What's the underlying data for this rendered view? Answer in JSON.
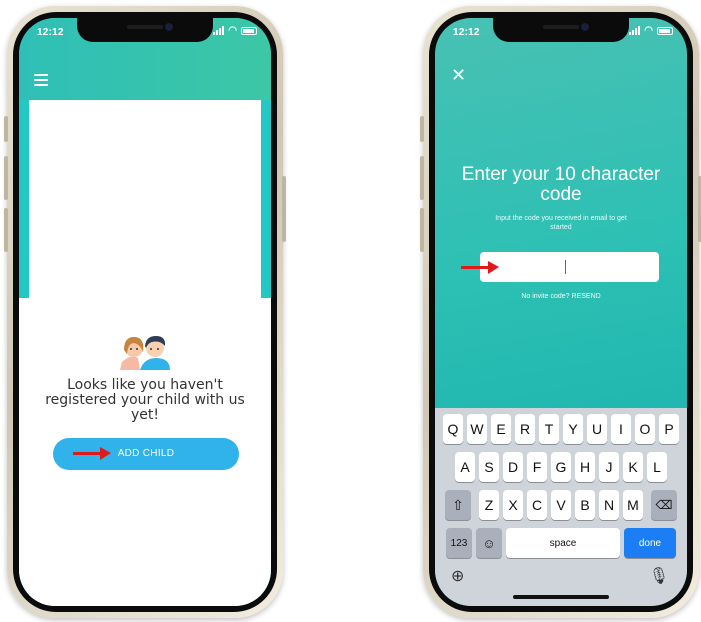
{
  "phone_left": {
    "status": {
      "time": "12:12"
    },
    "menu_icon": "hamburger-icon",
    "illustration": "children-icon",
    "empty_message": "Looks like you haven't registered your child with us yet!",
    "add_child_label": "ADD CHILD",
    "colors": {
      "header": "#2fbfb6",
      "button": "#2fb3ea",
      "arrow": "#e0191d"
    }
  },
  "phone_right": {
    "status": {
      "time": "12:12"
    },
    "close_icon": "close-icon",
    "title": "Enter your 10 character code",
    "subtitle": "Input the code you received in email to get started",
    "code_value": "",
    "resend_text": "No invite code? RESEND",
    "keyboard": {
      "row1": [
        "Q",
        "W",
        "E",
        "R",
        "T",
        "Y",
        "U",
        "I",
        "O",
        "P"
      ],
      "row2": [
        "A",
        "S",
        "D",
        "F",
        "G",
        "H",
        "J",
        "K",
        "L"
      ],
      "row3": [
        "Z",
        "X",
        "C",
        "V",
        "B",
        "N",
        "M"
      ],
      "key_123": "123",
      "space": "space",
      "done": "done"
    },
    "colors": {
      "background": "#2ec0b4",
      "done_key": "#1c7ef4"
    }
  }
}
